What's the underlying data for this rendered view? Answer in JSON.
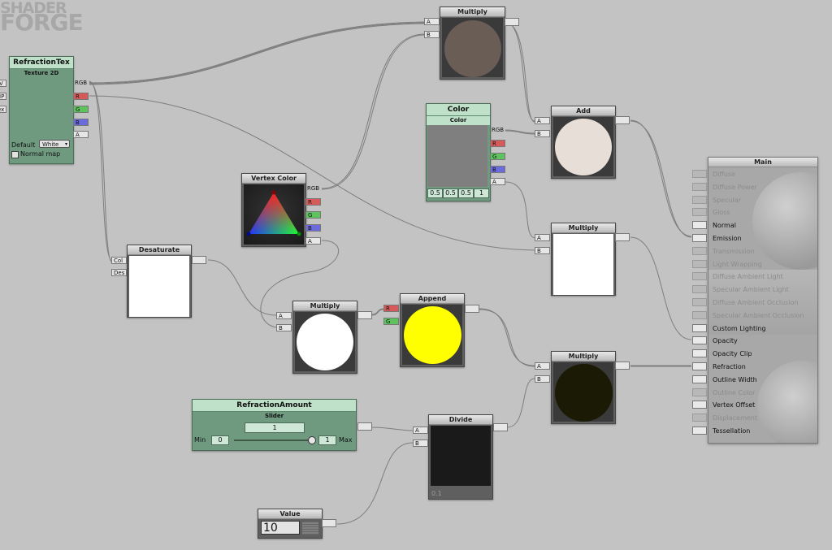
{
  "logo": {
    "line1": "SHADER",
    "line2": "FORGE"
  },
  "texture_node": {
    "title": "RefractionTex",
    "subtitle": "Texture 2D",
    "inputs": [
      "V",
      "IP",
      "ex"
    ],
    "outputs": [
      "RGB",
      "R",
      "G",
      "B",
      "A"
    ],
    "default_label": "Default",
    "default_value": "White",
    "normal_map_label": "Normal map",
    "normal_map_checked": false
  },
  "multiply_top": {
    "title": "Multiply",
    "inputs": [
      "A",
      "B"
    ],
    "preview_color": "#6a5d56"
  },
  "color_node": {
    "title": "Color",
    "subtitle": "Color",
    "outputs": [
      "RGB",
      "R",
      "G",
      "B",
      "A"
    ],
    "values": [
      "0.5",
      "0.5",
      "0.5",
      "1"
    ],
    "preview_color": "#7f7f7f"
  },
  "add_node": {
    "title": "Add",
    "inputs": [
      "A",
      "B"
    ],
    "preview_color": "#e8ded8"
  },
  "vertex_color_node": {
    "title": "Vertex Color",
    "outputs": [
      "RGB",
      "R",
      "G",
      "B",
      "A"
    ]
  },
  "multiply_mid": {
    "title": "Multiply",
    "inputs": [
      "A",
      "B"
    ],
    "preview_color": "#ffffff"
  },
  "desaturate_node": {
    "title": "Desaturate",
    "inputs": [
      "Col",
      "Des"
    ],
    "preview_color": "#ffffff"
  },
  "multiply_center": {
    "title": "Multiply",
    "inputs": [
      "A",
      "B"
    ],
    "preview_color": "#ffffff"
  },
  "append_node": {
    "title": "Append",
    "inputs": [
      "R",
      "G"
    ],
    "preview_color": "#ffff00"
  },
  "multiply_bottom": {
    "title": "Multiply",
    "inputs": [
      "A",
      "B"
    ],
    "preview_color": "#1a1a05"
  },
  "slider_node": {
    "title": "RefractionAmount",
    "subtitle": "Slider",
    "value": "1",
    "min_label": "Min",
    "min_value": "0",
    "max_label": "Max",
    "max_value": "1",
    "slider_fraction": 1.0
  },
  "divide_node": {
    "title": "Divide",
    "inputs": [
      "A",
      "B"
    ],
    "preview_color": "#1a1a1a",
    "value_text": "0.1"
  },
  "value_node": {
    "title": "Value",
    "value": "10"
  },
  "main_node": {
    "title": "Main",
    "inputs": [
      {
        "label": "Diffuse",
        "active": false
      },
      {
        "label": "Diffuse Power",
        "active": false
      },
      {
        "label": "Specular",
        "active": false
      },
      {
        "label": "Gloss",
        "active": false
      },
      {
        "label": "Normal",
        "active": true
      },
      {
        "label": "Emission",
        "active": true
      },
      {
        "label": "Transmission",
        "active": false
      },
      {
        "label": "Light Wrapping",
        "active": false
      },
      {
        "label": "Diffuse Ambient Light",
        "active": false
      },
      {
        "label": "Specular Ambient Light",
        "active": false
      },
      {
        "label": "Diffuse Ambient Occlusion",
        "active": false
      },
      {
        "label": "Specular Ambient Occlusion",
        "active": false
      },
      {
        "label": "Custom Lighting",
        "active": true
      },
      {
        "label": "Opacity",
        "active": true
      },
      {
        "label": "Opacity Clip",
        "active": true
      },
      {
        "label": "Refraction",
        "active": true
      },
      {
        "label": "Outline Width",
        "active": true
      },
      {
        "label": "Outline Color",
        "active": false
      },
      {
        "label": "Vertex Offset",
        "active": true
      },
      {
        "label": "Displacement",
        "active": false
      },
      {
        "label": "Tessellation",
        "active": true
      }
    ]
  },
  "colors": {
    "canvas": "#c3c3c3",
    "node_green": "#6f9a80",
    "port_r": "#d65a5a",
    "port_g": "#5ec25e",
    "port_b": "#6b6bdb"
  }
}
